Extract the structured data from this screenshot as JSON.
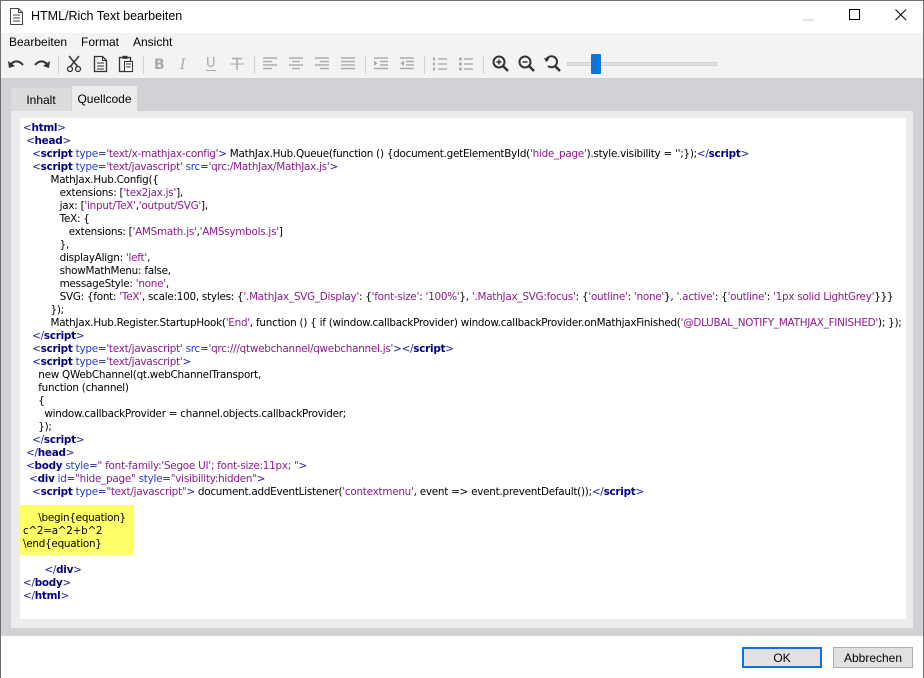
{
  "window": {
    "title": "HTML/Rich Text bearbeiten",
    "controls": [
      "minimize",
      "maximize",
      "close"
    ]
  },
  "menu": {
    "items": [
      {
        "label": "Bearbeiten"
      },
      {
        "label": "Format"
      },
      {
        "label": "Ansicht"
      }
    ]
  },
  "toolbar": {
    "buttons": [
      {
        "name": "undo-icon",
        "enabled": true
      },
      {
        "name": "redo-icon",
        "enabled": true
      },
      {
        "name": "cut-icon",
        "enabled": true
      },
      {
        "name": "copy-icon",
        "enabled": true
      },
      {
        "name": "paste-icon",
        "enabled": true
      },
      {
        "name": "bold-icon",
        "enabled": false
      },
      {
        "name": "italic-icon",
        "enabled": false
      },
      {
        "name": "underline-icon",
        "enabled": false
      },
      {
        "name": "strikethrough-icon",
        "enabled": false
      },
      {
        "name": "align-left-icon",
        "enabled": false
      },
      {
        "name": "align-center-icon",
        "enabled": false
      },
      {
        "name": "align-right-icon",
        "enabled": false
      },
      {
        "name": "align-justify-icon",
        "enabled": false
      },
      {
        "name": "indent-icon",
        "enabled": false
      },
      {
        "name": "outdent-icon",
        "enabled": false
      },
      {
        "name": "numbered-list-icon",
        "enabled": false
      },
      {
        "name": "bullet-list-icon",
        "enabled": false
      },
      {
        "name": "zoom-in-icon",
        "enabled": true
      },
      {
        "name": "zoom-out-icon",
        "enabled": true
      },
      {
        "name": "zoom-reset-icon",
        "enabled": true
      }
    ],
    "zoom_slider_fraction": 0.18,
    "accent_color": "#0a74da"
  },
  "tabs": [
    {
      "label": "Inhalt",
      "active": false
    },
    {
      "label": "Quellcode",
      "active": true
    }
  ],
  "source_lines": [
    [
      [
        "tg",
        "<"
      ],
      [
        "tn",
        "html"
      ],
      [
        "tg",
        ">"
      ]
    ],
    [
      [
        "t",
        " "
      ],
      [
        "tg",
        "<"
      ],
      [
        "tn",
        "head"
      ],
      [
        "tg",
        ">"
      ]
    ],
    [
      [
        "t",
        "   "
      ],
      [
        "tg",
        "<"
      ],
      [
        "tn",
        "script"
      ],
      [
        "at",
        " type"
      ],
      [
        "tg",
        "="
      ],
      [
        "sv",
        "'text/x-mathjax-config'"
      ],
      [
        "tg",
        ">"
      ],
      [
        "t",
        " MathJax.Hub.Queue(function () {document.getElementById("
      ],
      [
        "sv",
        "'hide_page'"
      ],
      [
        "t",
        ").style.visibility = '';});"
      ],
      [
        "tg",
        "</"
      ],
      [
        "tn",
        "script"
      ],
      [
        "tg",
        ">"
      ]
    ],
    [
      [
        "t",
        "   "
      ],
      [
        "tg",
        "<"
      ],
      [
        "tn",
        "script"
      ],
      [
        "at",
        " type"
      ],
      [
        "tg",
        "="
      ],
      [
        "sv",
        "'text/javascript'"
      ],
      [
        "at",
        " src"
      ],
      [
        "tg",
        "="
      ],
      [
        "sv",
        "'qrc:/MathJax/MathJax.js'"
      ],
      [
        "tg",
        ">"
      ]
    ],
    [
      [
        "t",
        "         MathJax.Hub.Config({"
      ]
    ],
    [
      [
        "t",
        "            extensions: ["
      ],
      [
        "sv",
        "'tex2jax.js'"
      ],
      [
        "t",
        "],"
      ]
    ],
    [
      [
        "t",
        "            jax: ["
      ],
      [
        "sv",
        "'input/TeX'"
      ],
      [
        "t",
        ","
      ],
      [
        "sv",
        "'output/SVG'"
      ],
      [
        "t",
        "],"
      ]
    ],
    [
      [
        "t",
        "            TeX: {"
      ]
    ],
    [
      [
        "t",
        "               extensions: ["
      ],
      [
        "sv",
        "'AMSmath.js'"
      ],
      [
        "t",
        ","
      ],
      [
        "sv",
        "'AMSsymbols.js'"
      ],
      [
        "t",
        "]"
      ]
    ],
    [
      [
        "t",
        "            },"
      ]
    ],
    [
      [
        "t",
        "            displayAlign: "
      ],
      [
        "sv",
        "'left'"
      ],
      [
        "t",
        ","
      ]
    ],
    [
      [
        "t",
        "            showMathMenu: false,"
      ]
    ],
    [
      [
        "t",
        "            messageStyle: "
      ],
      [
        "sv",
        "'none'"
      ],
      [
        "t",
        ","
      ]
    ],
    [
      [
        "t",
        "            SVG: {font: "
      ],
      [
        "sv",
        "'TeX'"
      ],
      [
        "t",
        ", scale:100, styles: {"
      ],
      [
        "sv",
        "'.MathJax_SVG_Display'"
      ],
      [
        "t",
        ": {"
      ],
      [
        "sv",
        "'font-size'"
      ],
      [
        "t",
        ": "
      ],
      [
        "sv",
        "'100%'"
      ],
      [
        "t",
        "}, "
      ],
      [
        "sv",
        "'.MathJax_SVG:focus'"
      ],
      [
        "t",
        ": {"
      ],
      [
        "sv",
        "'outline'"
      ],
      [
        "t",
        ": "
      ],
      [
        "sv",
        "'none'"
      ],
      [
        "t",
        "}, "
      ],
      [
        "sv",
        "'.active'"
      ],
      [
        "t",
        ": {"
      ],
      [
        "sv",
        "'outline'"
      ],
      [
        "t",
        ": "
      ],
      [
        "sv",
        "'1px solid LightGrey'"
      ],
      [
        "t",
        "}}}"
      ]
    ],
    [
      [
        "t",
        "         });"
      ]
    ],
    [
      [
        "t",
        "         MathJax.Hub.Register.StartupHook("
      ],
      [
        "sv",
        "'End'"
      ],
      [
        "t",
        ", function () { if (window.callbackProvider) window.callbackProvider.onMathjaxFinished("
      ],
      [
        "sv",
        "'@DLUBAL_NOTIFY_MATHJAX_FINISHED'"
      ],
      [
        "t",
        "); });"
      ]
    ],
    [
      [
        "t",
        "   "
      ],
      [
        "tg",
        "</"
      ],
      [
        "tn",
        "script"
      ],
      [
        "tg",
        ">"
      ]
    ],
    [
      [
        "t",
        "   "
      ],
      [
        "tg",
        "<"
      ],
      [
        "tn",
        "script"
      ],
      [
        "at",
        " type"
      ],
      [
        "tg",
        "="
      ],
      [
        "sv",
        "'text/javascript'"
      ],
      [
        "at",
        " src"
      ],
      [
        "tg",
        "="
      ],
      [
        "sv",
        "'qrc:///qtwebchannel/qwebchannel.js'"
      ],
      [
        "tg",
        "></"
      ],
      [
        "tn",
        "script"
      ],
      [
        "tg",
        ">"
      ]
    ],
    [
      [
        "t",
        "   "
      ],
      [
        "tg",
        "<"
      ],
      [
        "tn",
        "script"
      ],
      [
        "at",
        " type"
      ],
      [
        "tg",
        "="
      ],
      [
        "sv",
        "'text/javascript'"
      ],
      [
        "tg",
        ">"
      ]
    ],
    [
      [
        "t",
        "     new QWebChannel(qt.webChannelTransport,"
      ]
    ],
    [
      [
        "t",
        "     function (channel)"
      ]
    ],
    [
      [
        "t",
        "     {"
      ]
    ],
    [
      [
        "t",
        "       window.callbackProvider = channel.objects.callbackProvider;"
      ]
    ],
    [
      [
        "t",
        "     });"
      ]
    ],
    [
      [
        "t",
        "   "
      ],
      [
        "tg",
        "</"
      ],
      [
        "tn",
        "script"
      ],
      [
        "tg",
        ">"
      ]
    ],
    [
      [
        "t",
        " "
      ],
      [
        "tg",
        "</"
      ],
      [
        "tn",
        "head"
      ],
      [
        "tg",
        ">"
      ]
    ],
    [
      [
        "t",
        " "
      ],
      [
        "tg",
        "<"
      ],
      [
        "tn",
        "body"
      ],
      [
        "at",
        " style"
      ],
      [
        "tg",
        "="
      ],
      [
        "sv",
        "\" font-family:'Segoe UI'; font-size:11px; \""
      ],
      [
        "tg",
        ">"
      ]
    ],
    [
      [
        "t",
        "  "
      ],
      [
        "tg",
        "<"
      ],
      [
        "tn",
        "div"
      ],
      [
        "at",
        " id"
      ],
      [
        "tg",
        "="
      ],
      [
        "sv",
        "\"hide_page\""
      ],
      [
        "at",
        " style"
      ],
      [
        "tg",
        "="
      ],
      [
        "sv",
        "\"visibility:hidden\""
      ],
      [
        "tg",
        ">"
      ]
    ],
    [
      [
        "t",
        "   "
      ],
      [
        "tg",
        "<"
      ],
      [
        "tn",
        "script"
      ],
      [
        "at",
        " type"
      ],
      [
        "tg",
        "="
      ],
      [
        "sv",
        "\"text/javascript\""
      ],
      [
        "tg",
        ">"
      ],
      [
        "t",
        " document.addEventListener("
      ],
      [
        "sv",
        "'contextmenu'"
      ],
      [
        "t",
        ", event => event.preventDefault());"
      ],
      [
        "tg",
        "</"
      ],
      [
        "tn",
        "script"
      ],
      [
        "tg",
        ">"
      ]
    ],
    [],
    [
      [
        "t",
        "     \\begin{equation}"
      ]
    ],
    [
      [
        "t",
        "c^2=a^2+b^2"
      ]
    ],
    [
      [
        "t",
        "\\end{equation}"
      ]
    ],
    [],
    [
      [
        "t",
        "       "
      ],
      [
        "tg",
        "</"
      ],
      [
        "tn",
        "div"
      ],
      [
        "tg",
        ">"
      ]
    ],
    [
      [
        "tg",
        "</"
      ],
      [
        "tn",
        "body"
      ],
      [
        "tg",
        ">"
      ]
    ],
    [
      [
        "tg",
        "</"
      ],
      [
        "tn",
        "html"
      ],
      [
        "tg",
        ">"
      ]
    ]
  ],
  "footer": {
    "ok_label": "OK",
    "cancel_label": "Abbrechen"
  }
}
